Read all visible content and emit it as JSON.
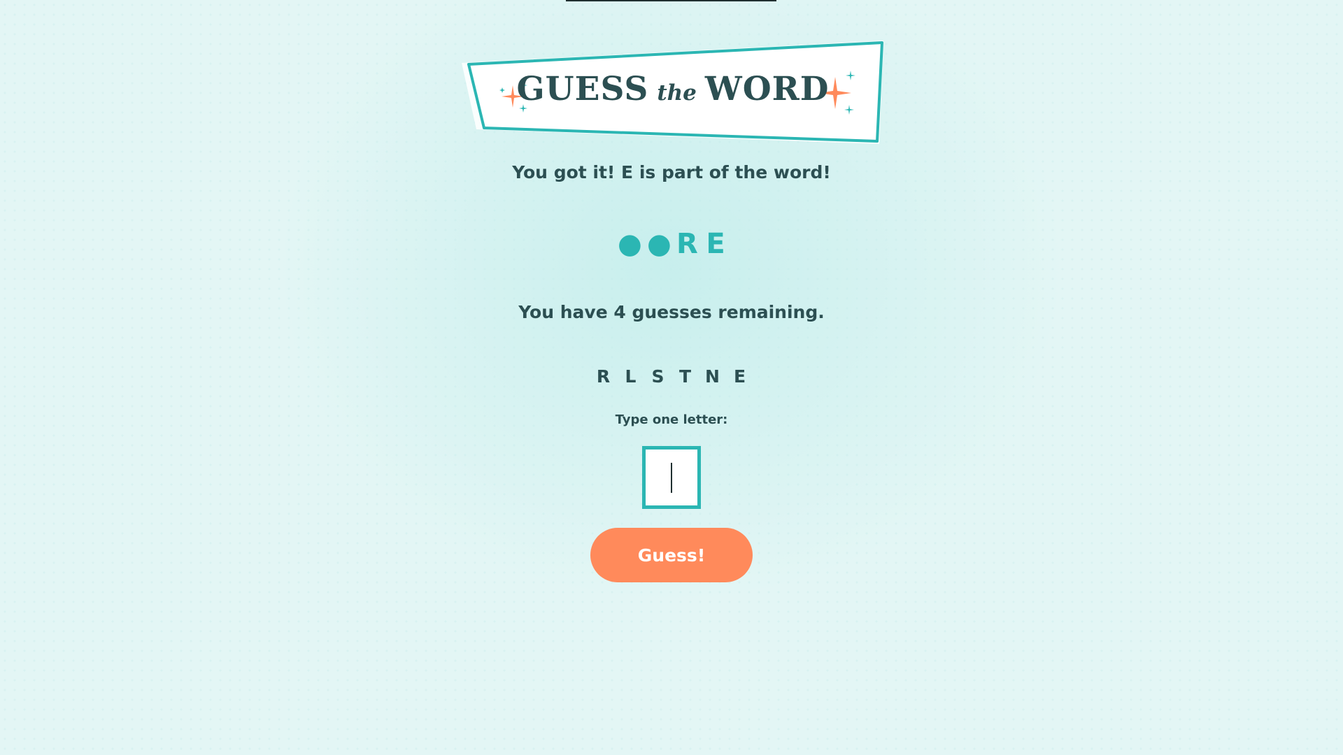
{
  "banner": {
    "title_left": "GUESS",
    "title_middle": "the",
    "title_right": "WORD",
    "colors": {
      "border": "#2bb6b3",
      "fill": "#ffffff",
      "star_coral": "#ff8a5b",
      "star_teal": "#2bb6b3",
      "text": "#2c4f52"
    }
  },
  "message": "You got it! E is part of the word!",
  "word_progress": [
    "●",
    "●",
    "R",
    "E"
  ],
  "remaining_message": "You have 4 guesses remaining.",
  "guessed_letters": [
    "R",
    "L",
    "S",
    "T",
    "N",
    "E"
  ],
  "input": {
    "label": "Type one letter:",
    "value": ""
  },
  "guess_button_label": "Guess!",
  "colors": {
    "accent": "#2bb6b3",
    "button": "#ff8a5b",
    "text": "#2c4f52",
    "background": "#e3f6f5"
  }
}
